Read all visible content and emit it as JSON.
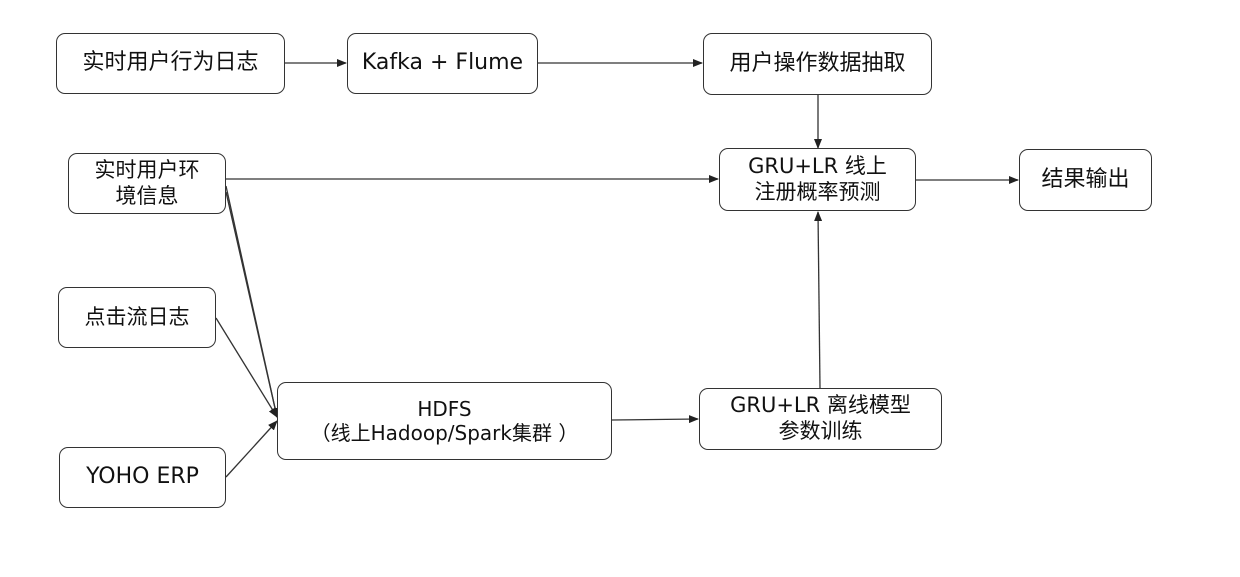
{
  "nodes": {
    "realtime_behavior_log": {
      "label": "实时用户行为日志"
    },
    "kafka_flume": {
      "label": "Kafka + Flume"
    },
    "user_op_extract": {
      "label": "用户操作数据抽取"
    },
    "realtime_env_info": {
      "line1": "实时用户环",
      "line2": "境信息"
    },
    "gru_lr_online": {
      "line1": "GRU+LR 线上",
      "line2": "注册概率预测"
    },
    "result_output": {
      "label": "结果输出"
    },
    "clickstream_log": {
      "label": "点击流日志"
    },
    "hdfs": {
      "line1": "HDFS",
      "line2": "（线上Hadoop/Spark集群 ）"
    },
    "gru_lr_offline": {
      "line1": "GRU+LR 离线模型",
      "line2": "参数训练"
    },
    "yoho_erp": {
      "label": "YOHO ERP"
    }
  },
  "colors": {
    "stroke": "#333333",
    "text": "#111111",
    "background": "#ffffff"
  }
}
